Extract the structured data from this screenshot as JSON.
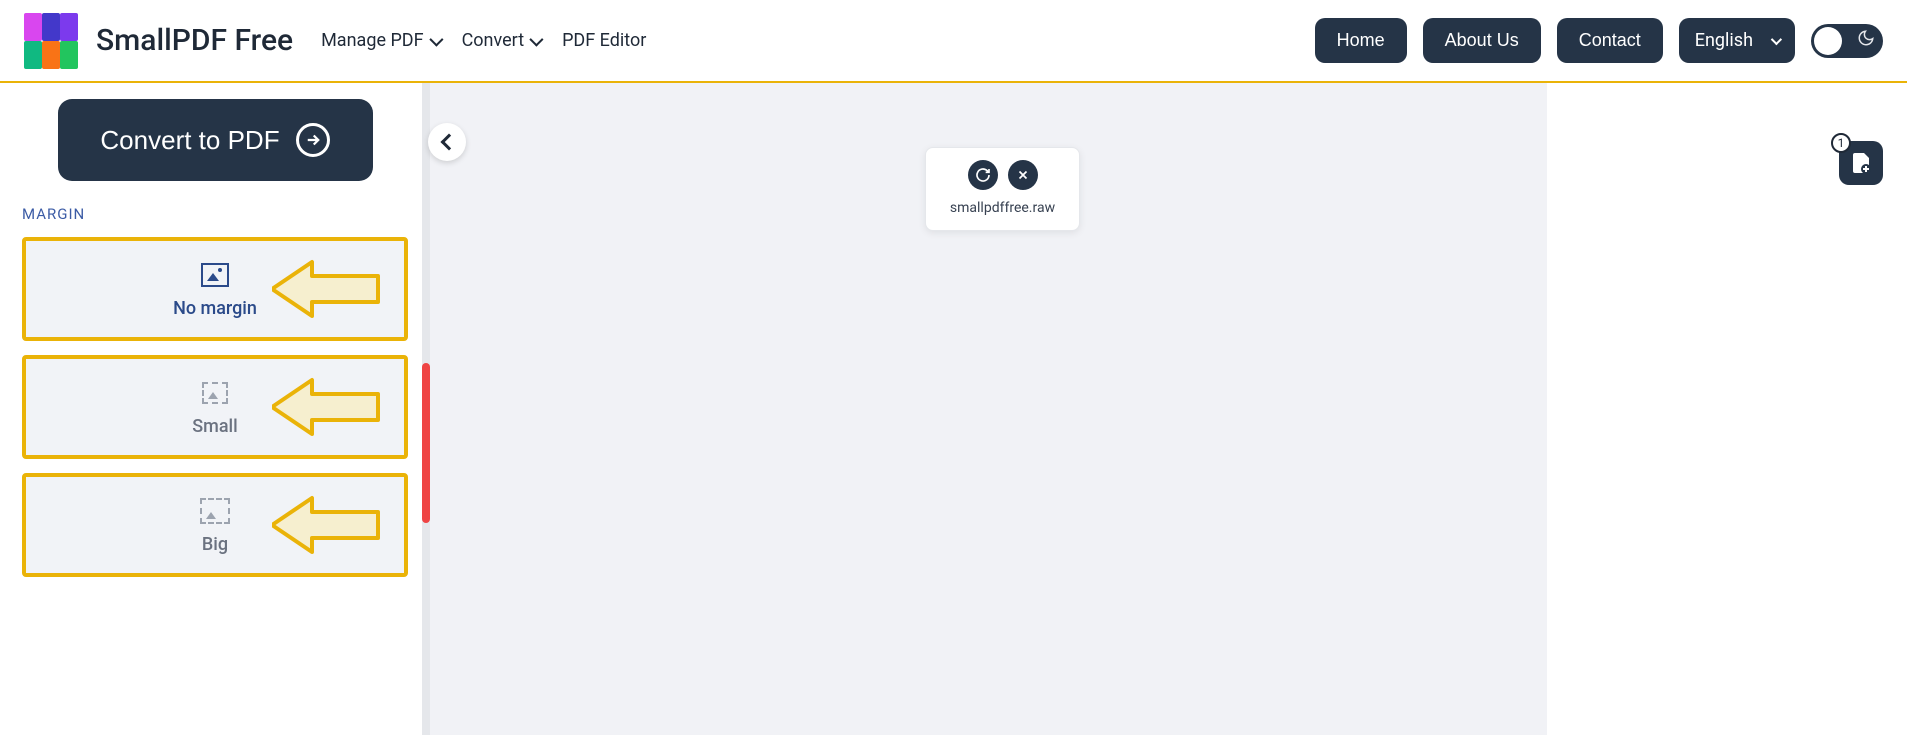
{
  "header": {
    "brand": "SmallPDF Free",
    "nav": {
      "manage": "Manage PDF",
      "convert": "Convert",
      "editor": "PDF Editor"
    },
    "buttons": {
      "home": "Home",
      "about": "About Us",
      "contact": "Contact"
    },
    "language": "English"
  },
  "sidebar": {
    "convert_label": "Convert to PDF",
    "section": "MARGIN",
    "options": {
      "none": "No margin",
      "small": "Small",
      "big": "Big"
    }
  },
  "main": {
    "file_name": "smallpdffree.raw",
    "file_count": "1"
  }
}
